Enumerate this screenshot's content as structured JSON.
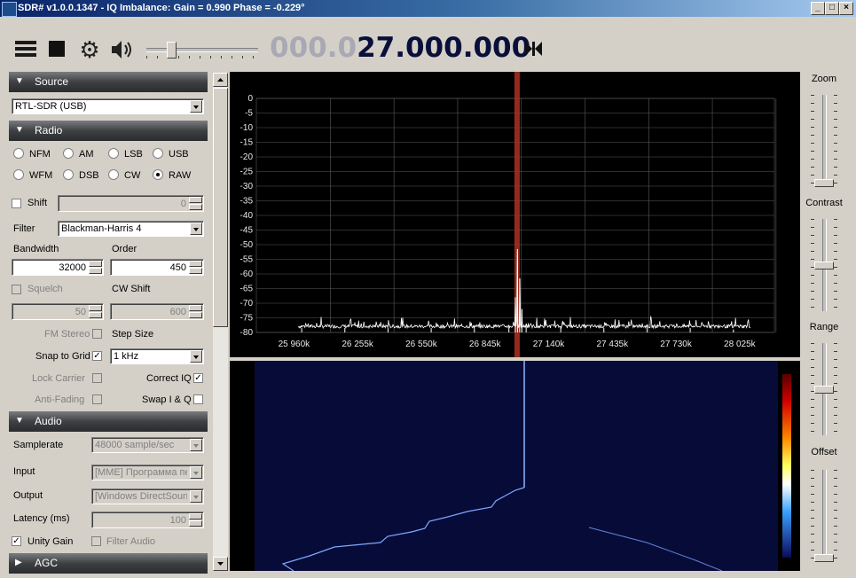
{
  "window": {
    "title": "SDR# v1.0.0.1347 - IQ Imbalance: Gain = 0.990 Phase = -0.229°",
    "min_label": "_",
    "max_label": "□",
    "close_label": "×"
  },
  "toolbar": {
    "menu_icon": "hamburger-menu-icon",
    "stop_icon": "stop-icon",
    "settings_icon": "gear-icon",
    "volume_icon": "speaker-icon",
    "volume_level": 0.2,
    "frequency_dim": "000.0",
    "frequency_bright": "27.000.000",
    "tune_icon": "skip-tune-icon"
  },
  "sections": {
    "source": "Source",
    "radio": "Radio",
    "audio": "Audio",
    "agc": "AGC"
  },
  "source": {
    "device": "RTL-SDR (USB)"
  },
  "radio": {
    "modes_row1": [
      "NFM",
      "AM",
      "LSB",
      "USB"
    ],
    "modes_row2": [
      "WFM",
      "DSB",
      "CW",
      "RAW"
    ],
    "selected_mode": "RAW",
    "shift_label": "Shift",
    "shift_value": "0",
    "filter_label": "Filter",
    "filter_value": "Blackman-Harris 4",
    "bandwidth_label": "Bandwidth",
    "bandwidth_value": "32000",
    "order_label": "Order",
    "order_value": "450",
    "squelch_label": "Squelch",
    "squelch_value": "50",
    "cw_shift_label": "CW Shift",
    "cw_shift_value": "600",
    "fm_stereo_label": "FM Stereo",
    "step_size_label": "Step Size",
    "snap_label": "Snap to Grid",
    "snap_checked": "✓",
    "step_value": "1 kHz",
    "lock_carrier_label": "Lock Carrier",
    "correct_iq_label": "Correct IQ",
    "correct_iq_checked": "✓",
    "anti_fading_label": "Anti-Fading",
    "swap_iq_label": "Swap I & Q"
  },
  "audio": {
    "samplerate_label": "Samplerate",
    "samplerate_value": "48000 sample/sec",
    "input_label": "Input",
    "input_value": "[MME] Программа пе",
    "output_label": "Output",
    "output_value": "[Windows DirectSound",
    "latency_label": "Latency (ms)",
    "latency_value": "100",
    "unity_gain_label": "Unity Gain",
    "unity_gain_checked": "✓",
    "filter_audio_label": "Filter Audio"
  },
  "right_panel": {
    "zoom_label": "Zoom",
    "contrast_label": "Contrast",
    "range_label": "Range",
    "offset_label": "Offset",
    "zoom_level": 0.0,
    "contrast_level": 0.5,
    "range_level": 0.5,
    "offset_level": 0.0
  },
  "chart_data": {
    "type": "line",
    "title": "",
    "xlabel": "",
    "ylabel": "",
    "y_ticks": [
      0,
      -5,
      -10,
      -15,
      -20,
      -25,
      -30,
      -35,
      -40,
      -45,
      -50,
      -55,
      -60,
      -65,
      -70,
      -75,
      -80
    ],
    "ylim": [
      -80,
      0
    ],
    "x_tick_labels": [
      "25 960k",
      "26 255k",
      "26 550k",
      "26 845k",
      "27 140k",
      "27 435k",
      "27 730k",
      "28 025k"
    ],
    "grid": true,
    "center_frequency_label": "27 000k",
    "series": [
      {
        "x_khz": [
          26000,
          26200,
          26400,
          26600,
          26800,
          26960,
          26990,
          27000,
          27010,
          27020,
          27040,
          27200,
          27400,
          27600,
          27800,
          28000
        ],
        "y_db": [
          -78.5,
          -78.5,
          -78.5,
          -78.5,
          -78,
          -77.5,
          -68,
          -51.5,
          -61.5,
          -72,
          -77,
          -78,
          -78.5,
          -78,
          -78.5,
          -79
        ]
      }
    ],
    "colors": {
      "trace": "#ffffff",
      "grid": "#5a5a5a",
      "center_marker": "#b03020"
    }
  }
}
